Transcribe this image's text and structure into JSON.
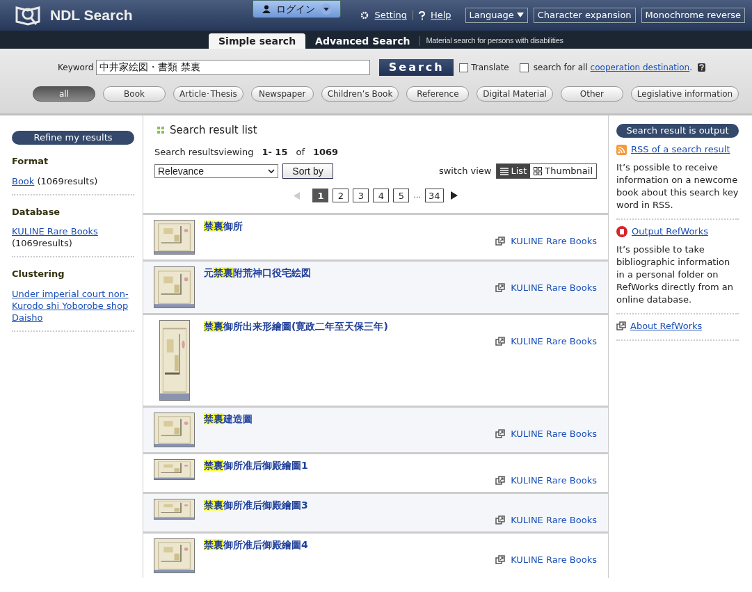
{
  "header": {
    "logo_text": "NDL Search",
    "login": "ログイン",
    "links": [
      "Setting",
      "Help"
    ],
    "buttons": [
      {
        "label": "Language",
        "kind": "dropdown"
      },
      {
        "label": "Character expansion",
        "kind": "plain"
      },
      {
        "label": "Monochrome reverse",
        "kind": "plain"
      }
    ]
  },
  "tabs": [
    {
      "label": "Simple search",
      "selected": true
    },
    {
      "label": "Advanced Search",
      "selected": false
    }
  ],
  "tabs_note": "Material search for persons with disabilities",
  "search": {
    "label": "Keyword",
    "value": "中井家絵図・書類 禁裏",
    "button": "Search",
    "translate": {
      "label": "Translate",
      "checked": false
    },
    "cooperation": {
      "checked": false,
      "before": "search for all",
      "link": "cooperation destination",
      "after": "."
    }
  },
  "categories": [
    {
      "label": "all",
      "selected": true
    },
    {
      "label": "Book",
      "selected": false
    },
    {
      "label": "Article･Thesis",
      "selected": false
    },
    {
      "label": "Newspaper",
      "selected": false
    },
    {
      "label": "Children’s Book",
      "selected": false
    },
    {
      "label": "Reference",
      "selected": false
    },
    {
      "label": "Digital Material",
      "selected": false
    },
    {
      "label": "Other",
      "selected": false
    },
    {
      "label": "Legislative information",
      "selected": false
    }
  ],
  "refine": {
    "title": "Refine my results",
    "sections": [
      {
        "heading": "Format",
        "items": [
          {
            "link": "Book",
            "count": "(1069results)"
          }
        ]
      },
      {
        "heading": "Database",
        "items": [
          {
            "link": "KULINE Rare Books",
            "count": "(1069results)"
          }
        ]
      },
      {
        "heading": "Clustering",
        "items": [
          {
            "link": "Under imperial court non-Kurodo shi Yoborobe shop Daisho"
          }
        ]
      }
    ]
  },
  "results": {
    "title": "Search result list",
    "summary_label": "Search resultsviewing",
    "range": "1- 15",
    "of": "of",
    "total": "1069",
    "sort_value": "Relevance",
    "sort_button": "Sort by",
    "switch_label": "switch view",
    "views": [
      {
        "label": "List",
        "selected": true
      },
      {
        "label": "Thumbnail",
        "selected": false
      }
    ],
    "pages": [
      {
        "label": "1",
        "selected": true
      },
      {
        "label": "2",
        "selected": false
      },
      {
        "label": "3",
        "selected": false
      },
      {
        "label": "4",
        "selected": false
      },
      {
        "label": "5",
        "selected": false
      },
      {
        "label": "...",
        "kind": "gap"
      },
      {
        "label": "34",
        "selected": false
      }
    ],
    "items": [
      {
        "title": [
          {
            "text": "禁裏",
            "highlight": true
          },
          {
            "text": "御所",
            "highlight": false
          }
        ],
        "source": "KULINE Rare Books",
        "kind": "wide"
      },
      {
        "title": [
          {
            "text": "元",
            "highlight": false
          },
          {
            "text": "禁裏",
            "highlight": true
          },
          {
            "text": "附荒神口役宅絵図",
            "highlight": false
          }
        ],
        "source": "KULINE Rare Books",
        "kind": "square"
      },
      {
        "title": [
          {
            "text": "禁裏",
            "highlight": true
          },
          {
            "text": "御所出来形繪圖(寛政二年至天保三年)",
            "highlight": false
          }
        ],
        "source": "KULINE Rare Books",
        "kind": "tall"
      },
      {
        "title": [
          {
            "text": "禁裏",
            "highlight": true
          },
          {
            "text": "建造圖",
            "highlight": false
          }
        ],
        "source": "KULINE Rare Books",
        "kind": "wide"
      },
      {
        "title": [
          {
            "text": "禁裏",
            "highlight": true
          },
          {
            "text": "御所准后御殿繪圖1",
            "highlight": false
          }
        ],
        "source": "KULINE Rare Books",
        "kind": "flat"
      },
      {
        "title": [
          {
            "text": "禁裏",
            "highlight": true
          },
          {
            "text": "御所准后御殿繪圖3",
            "highlight": false
          }
        ],
        "source": "KULINE Rare Books",
        "kind": "flat"
      },
      {
        "title": [
          {
            "text": "禁裏",
            "highlight": true
          },
          {
            "text": "御所准后御殿繪圖4",
            "highlight": false
          }
        ],
        "source": "KULINE Rare Books",
        "kind": "wide"
      }
    ]
  },
  "output": {
    "title": "Search result is output",
    "blocks": [
      {
        "kind": "rss",
        "link": "RSS of a search result",
        "text": "It’s possible to receive information on a newcome book about this search key word in RSS."
      },
      {
        "kind": "refworks",
        "link": "Output RefWorks",
        "text": "It’s possible to take bibliographic information in a personal folder on RefWorks directly from an online database."
      },
      {
        "kind": "external",
        "link": "About RefWorks"
      }
    ]
  }
}
